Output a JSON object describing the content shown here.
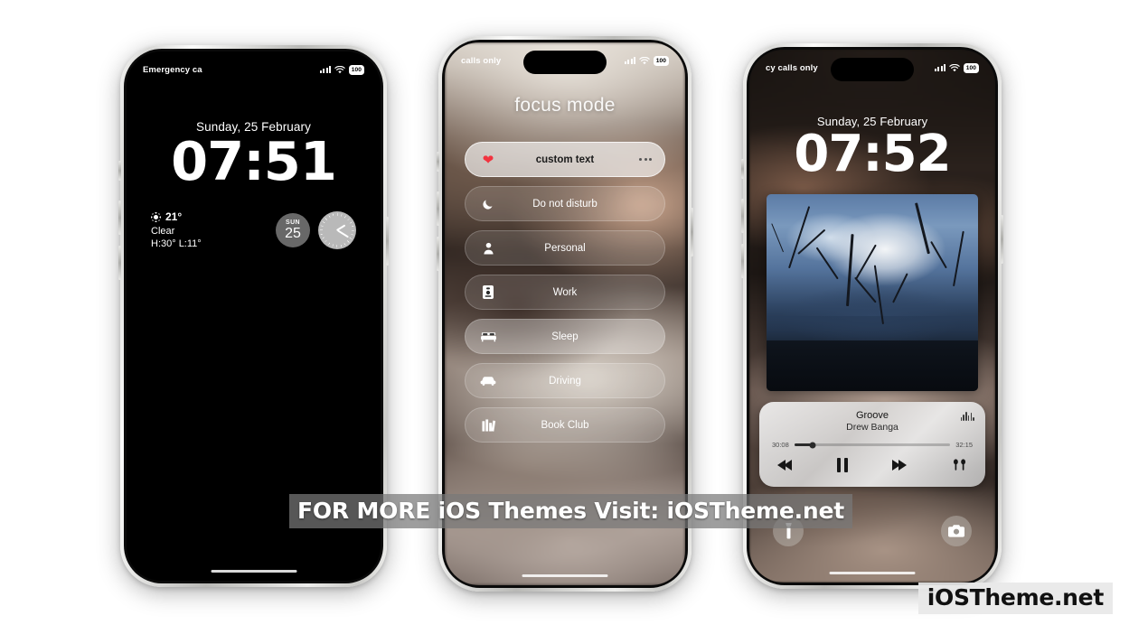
{
  "banner": {
    "text": "FOR MORE iOS Themes Visit: iOSTheme.net"
  },
  "watermark": {
    "text": "iOSTheme.net"
  },
  "phones": [
    {
      "id": "phone-1",
      "status": {
        "carrier": "Emergency ca",
        "battery": "100"
      },
      "lock": {
        "date": "Sunday, 25 February",
        "time": "07:51"
      },
      "weather": {
        "temp": "21°",
        "condition": "Clear",
        "range": "H:30° L:11°"
      },
      "calendar": {
        "dow": "SUN",
        "day": "25"
      }
    },
    {
      "id": "phone-2",
      "status": {
        "carrier": "calls only",
        "battery": "100"
      },
      "focus": {
        "title": "focus mode",
        "items": [
          {
            "label": "custom text",
            "icon": "heart-icon",
            "state": "active"
          },
          {
            "label": "Do not disturb",
            "icon": "moon-icon",
            "state": "dim"
          },
          {
            "label": "Personal",
            "icon": "person-icon",
            "state": "dim"
          },
          {
            "label": "Work",
            "icon": "briefcase-icon",
            "state": "dim"
          },
          {
            "label": "Sleep",
            "icon": "bed-icon",
            "state": "bright"
          },
          {
            "label": "Driving",
            "icon": "car-icon",
            "state": "dim"
          },
          {
            "label": "Book Club",
            "icon": "books-icon",
            "state": "dim"
          }
        ]
      }
    },
    {
      "id": "phone-3",
      "status": {
        "carrier": "cy calls only",
        "battery": "100"
      },
      "lock": {
        "date": "Sunday, 25 February",
        "time": "07:52"
      },
      "player": {
        "title": "Groove",
        "artist": "Drew Banga",
        "elapsed": "30:08",
        "duration": "32:15"
      }
    }
  ]
}
